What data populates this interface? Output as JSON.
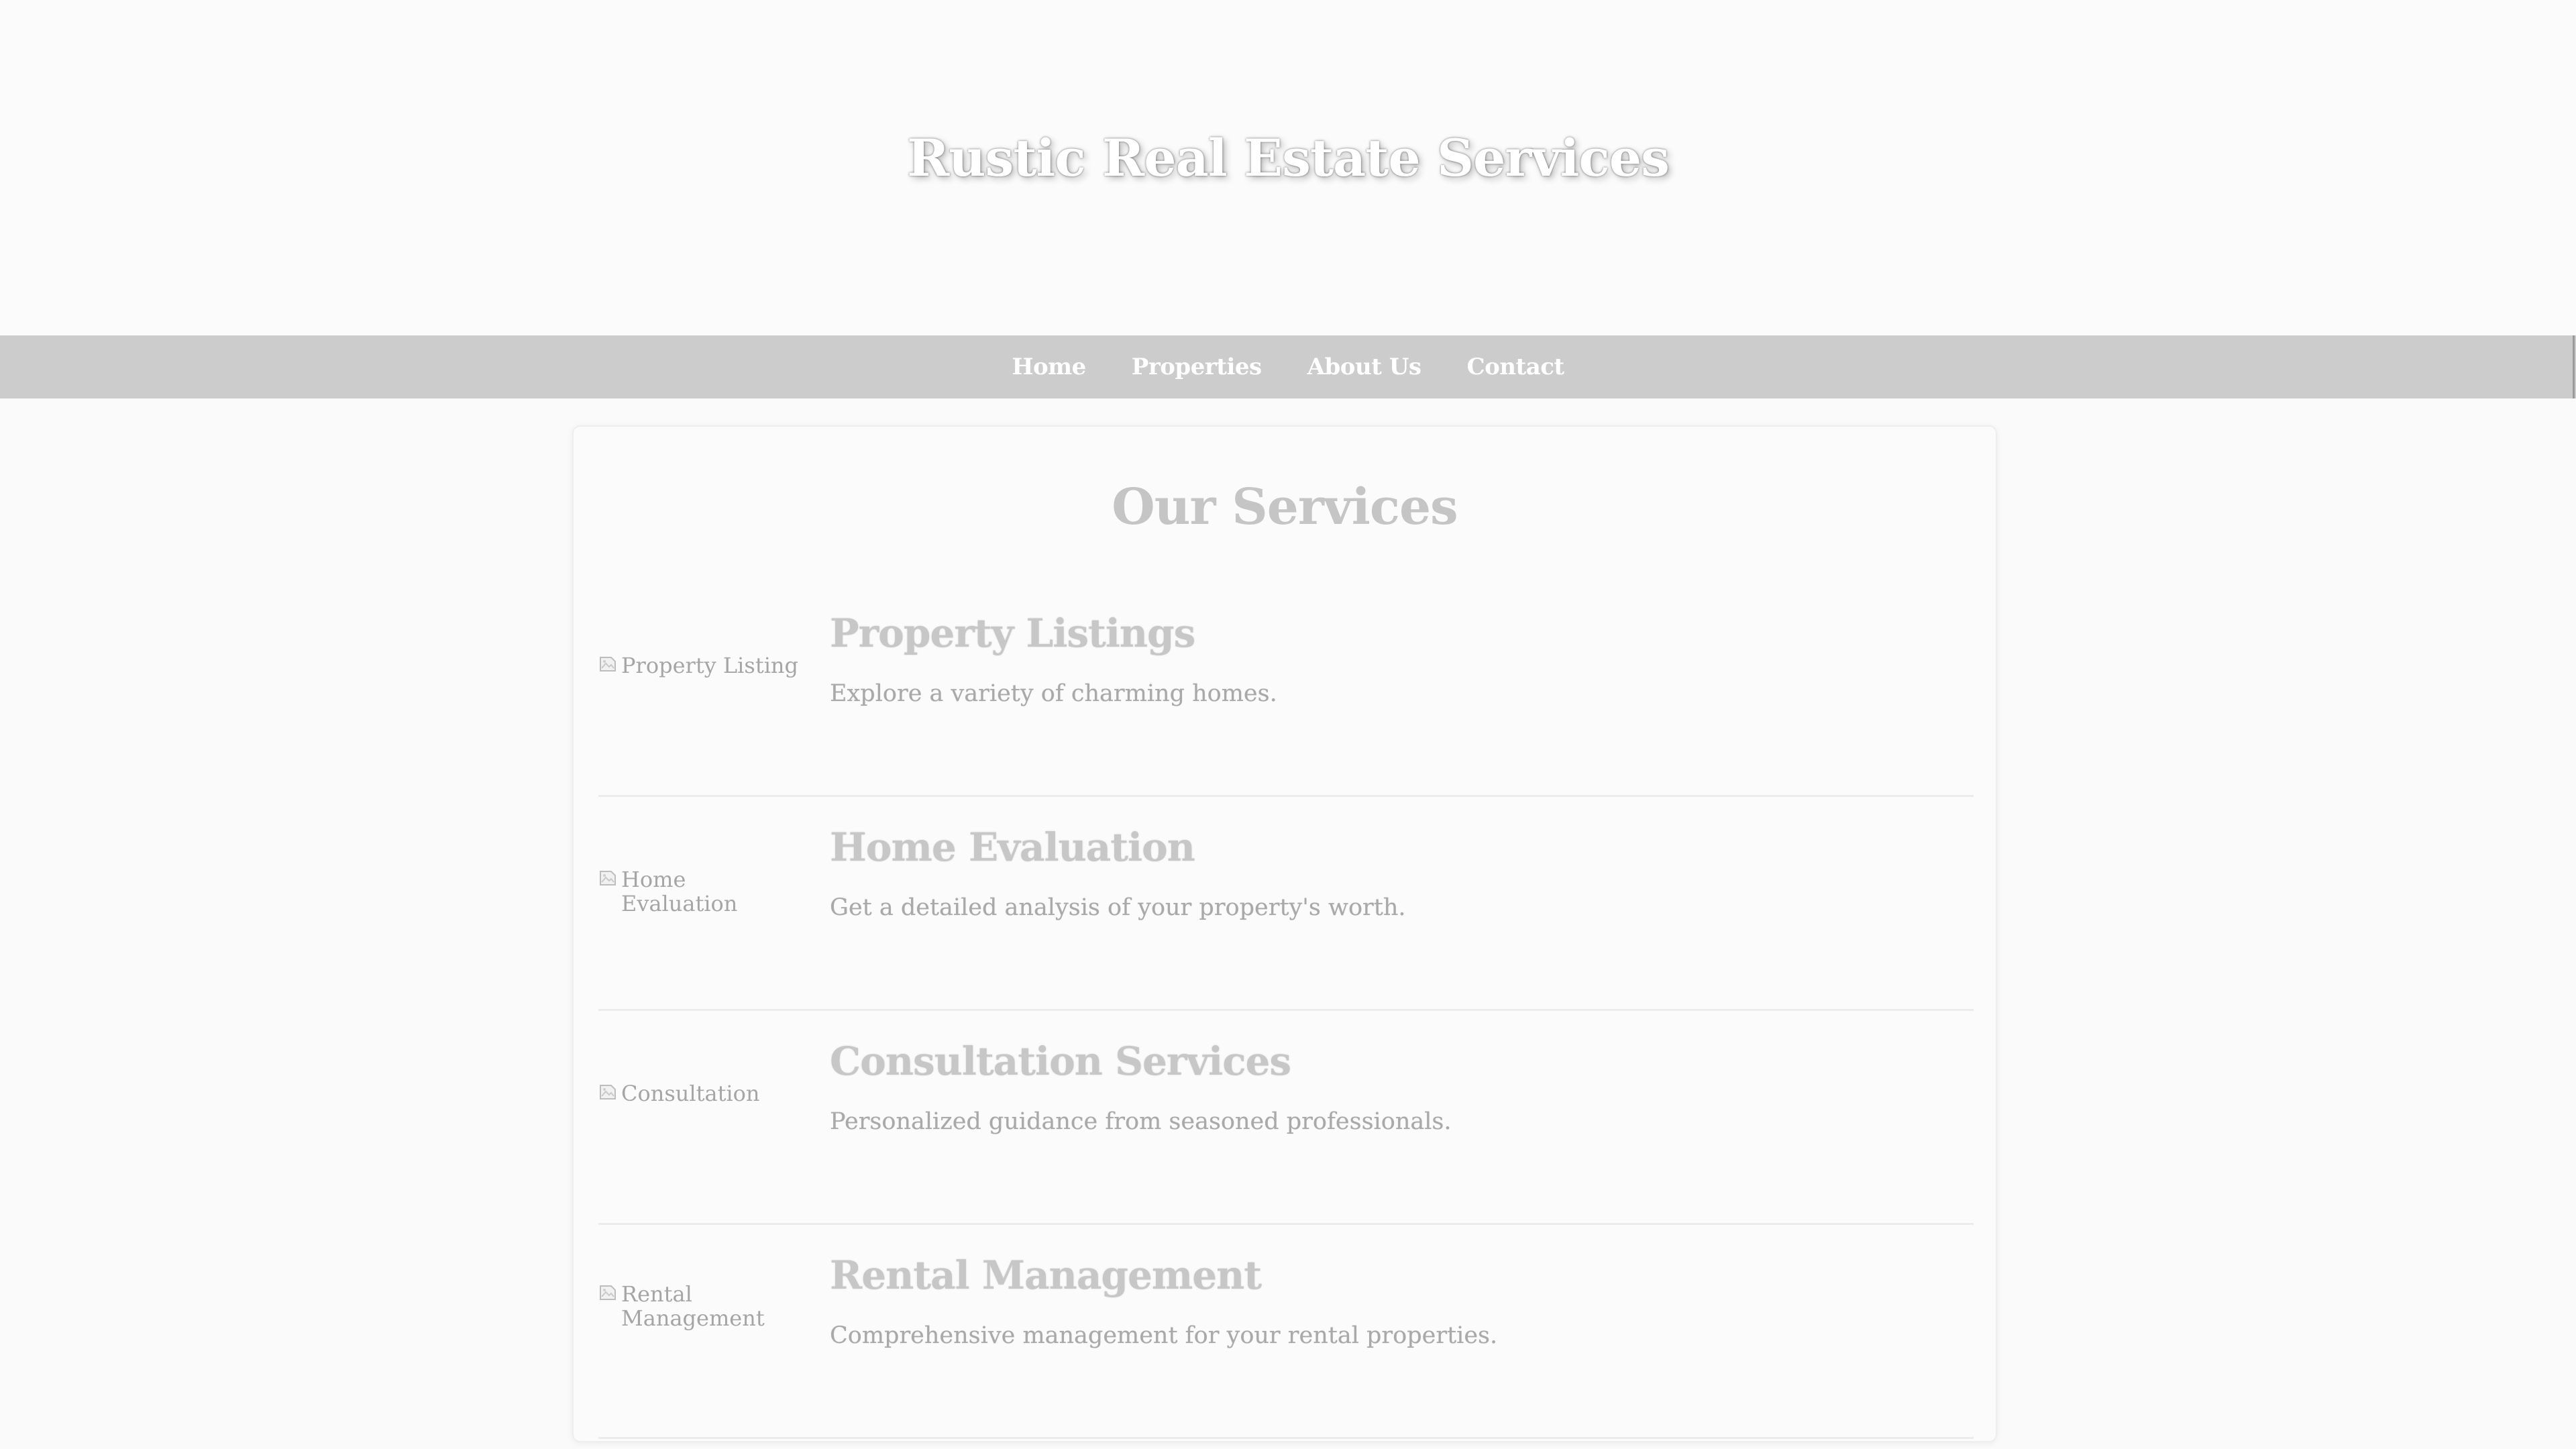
{
  "header": {
    "title": "Rustic Real Estate Services"
  },
  "nav": {
    "items": [
      {
        "label": "Home"
      },
      {
        "label": "Properties"
      },
      {
        "label": "About Us"
      },
      {
        "label": "Contact"
      }
    ]
  },
  "main": {
    "section_title": "Our Services",
    "services": [
      {
        "image_alt": "Property Listing",
        "title": "Property Listings",
        "description": "Explore a variety of charming homes."
      },
      {
        "image_alt": "Home Evaluation",
        "title": "Home Evaluation",
        "description": "Get a detailed analysis of your property's worth."
      },
      {
        "image_alt": "Consultation",
        "title": "Consultation Services",
        "description": "Personalized guidance from seasoned professionals."
      },
      {
        "image_alt": "Rental Management",
        "title": "Rental Management",
        "description": "Comprehensive management for your rental properties."
      }
    ]
  },
  "icons": {
    "broken_image": "broken-image-icon"
  },
  "colors": {
    "nav_background": "#cccccc",
    "page_background": "#fafafa",
    "hero_text": "#ffffff",
    "heading_text": "#c7c7c7"
  }
}
